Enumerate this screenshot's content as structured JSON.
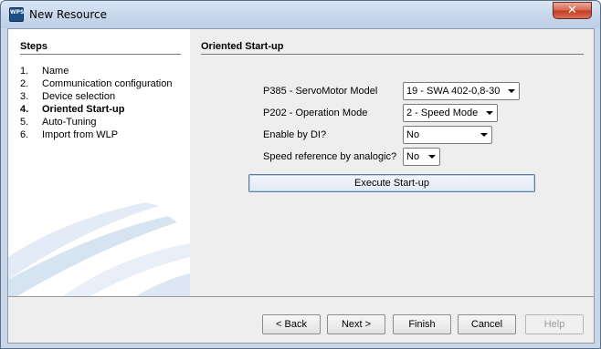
{
  "window": {
    "title": "New Resource",
    "app_icon_text": "WPS",
    "close_glyph": "✕"
  },
  "steps": {
    "header": "Steps",
    "items": [
      {
        "num": "1.",
        "label": "Name"
      },
      {
        "num": "2.",
        "label": "Communication configuration"
      },
      {
        "num": "3.",
        "label": "Device selection"
      },
      {
        "num": "4.",
        "label": "Oriented Start-up",
        "current": true
      },
      {
        "num": "5.",
        "label": "Auto-Tuning"
      },
      {
        "num": "6.",
        "label": "Import from WLP"
      }
    ]
  },
  "content": {
    "header": "Oriented Start-up",
    "fields": {
      "servomotor": {
        "label": "P385 - ServoMotor Model",
        "value": "19 - SWA 402-0,8-30"
      },
      "operation": {
        "label": "P202 - Operation Mode",
        "value": "2 - Speed Mode"
      },
      "enable_di": {
        "label": "Enable by DI?",
        "value": "No"
      },
      "speed_ref": {
        "label": "Speed reference by analogic?",
        "value": "No"
      }
    },
    "execute_label": "Execute Start-up"
  },
  "buttons": {
    "back": "< Back",
    "next": "Next >",
    "finish": "Finish",
    "cancel": "Cancel",
    "help": "Help"
  },
  "colors": {
    "frame": "#c9d7e8",
    "panel_bg": "#eeeeee",
    "steps_bg": "#ffffff",
    "swoosh": "#dbe7f4"
  }
}
